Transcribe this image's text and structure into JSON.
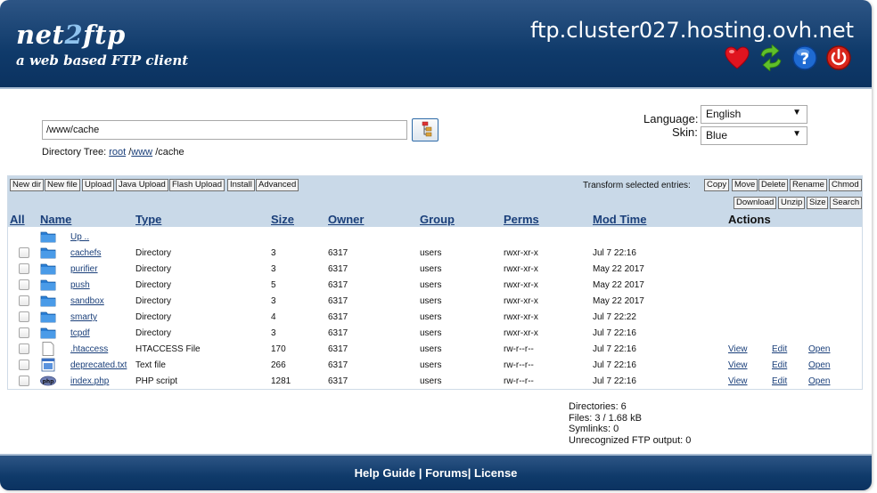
{
  "header": {
    "logo_left": "net",
    "logo_mid": "2",
    "logo_right": "ftp",
    "tagline": "a web based FTP client",
    "hostname": "ftp.cluster027.hosting.ovh.net",
    "icons": [
      "heart-icon",
      "refresh-icon",
      "help-icon",
      "power-icon"
    ]
  },
  "directory": {
    "value": "/www/cache",
    "tree_label": "Directory Tree:",
    "tree_root": "root",
    "tree_sep1": "/",
    "tree_www": "www",
    "tree_rest": "/cache"
  },
  "settings": {
    "language_label": "Language:",
    "language_value": "English",
    "skin_label": "Skin:",
    "skin_value": "Blue"
  },
  "toolbar": {
    "left_buttons": [
      "New dir",
      "New file",
      "Upload",
      "Java Upload",
      "Flash Upload",
      "Install",
      "Advanced"
    ],
    "transform_label": "Transform selected entries:",
    "right_buttons_row1": [
      "Copy",
      "Move",
      "Delete",
      "Rename",
      "Chmod"
    ],
    "right_buttons_row2": [
      "Download",
      "Unzip",
      "Size",
      "Search"
    ]
  },
  "table": {
    "headers": {
      "all": "All",
      "name": "Name",
      "type": "Type",
      "size": "Size",
      "owner": "Owner",
      "group": "Group",
      "perms": "Perms",
      "modtime": "Mod Time",
      "actions": "Actions"
    },
    "up": "Up ..",
    "rows": [
      {
        "name": "cachefs",
        "type": "Directory",
        "size": "3",
        "owner": "6317",
        "group": "users",
        "perms": "rwxr-xr-x",
        "mtime": "Jul 7 22:16",
        "icon": "folder-icon",
        "actions": []
      },
      {
        "name": "purifier",
        "type": "Directory",
        "size": "3",
        "owner": "6317",
        "group": "users",
        "perms": "rwxr-xr-x",
        "mtime": "May 22 2017",
        "icon": "folder-icon",
        "actions": []
      },
      {
        "name": "push",
        "type": "Directory",
        "size": "5",
        "owner": "6317",
        "group": "users",
        "perms": "rwxr-xr-x",
        "mtime": "May 22 2017",
        "icon": "folder-icon",
        "actions": []
      },
      {
        "name": "sandbox",
        "type": "Directory",
        "size": "3",
        "owner": "6317",
        "group": "users",
        "perms": "rwxr-xr-x",
        "mtime": "May 22 2017",
        "icon": "folder-icon",
        "actions": []
      },
      {
        "name": "smarty",
        "type": "Directory",
        "size": "4",
        "owner": "6317",
        "group": "users",
        "perms": "rwxr-xr-x",
        "mtime": "Jul 7 22:22",
        "icon": "folder-icon",
        "actions": []
      },
      {
        "name": "tcpdf",
        "type": "Directory",
        "size": "3",
        "owner": "6317",
        "group": "users",
        "perms": "rwxr-xr-x",
        "mtime": "Jul 7 22:16",
        "icon": "folder-icon",
        "actions": []
      },
      {
        "name": ".htaccess",
        "type": "HTACCESS File",
        "size": "170",
        "owner": "6317",
        "group": "users",
        "perms": "rw-r--r--",
        "mtime": "Jul 7 22:16",
        "icon": "file-icon",
        "actions": [
          "View",
          "Edit",
          "Open"
        ]
      },
      {
        "name": "deprecated.txt",
        "type": "Text file",
        "size": "266",
        "owner": "6317",
        "group": "users",
        "perms": "rw-r--r--",
        "mtime": "Jul 7 22:16",
        "icon": "text-file-icon",
        "actions": [
          "View",
          "Edit",
          "Open"
        ]
      },
      {
        "name": "index.php",
        "type": "PHP script",
        "size": "1281",
        "owner": "6317",
        "group": "users",
        "perms": "rw-r--r--",
        "mtime": "Jul 7 22:16",
        "icon": "php-file-icon",
        "actions": [
          "View",
          "Edit",
          "Open"
        ]
      }
    ]
  },
  "stats": {
    "directories": "Directories: 6",
    "files": "Files: 3 / 1.68 kB",
    "symlinks": "Symlinks: 0",
    "unrecognized": "Unrecognized FTP output: 0"
  },
  "footer": {
    "help": "Help Guide",
    "sep1": " | ",
    "forums": "Forums",
    "sep2": "| ",
    "license": "License"
  },
  "colors": {
    "header_blue": "#0f3a6a",
    "toolbar_bg": "#c9d9e8",
    "link": "#1a3f7a"
  }
}
